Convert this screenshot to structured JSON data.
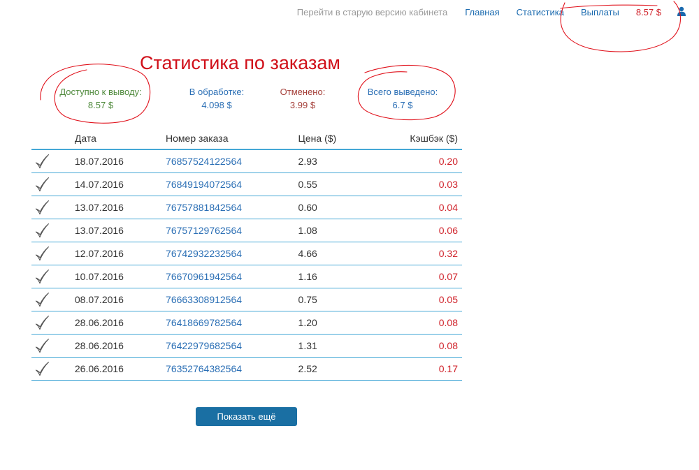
{
  "nav": {
    "old_version": "Перейти в старую версию кабинета",
    "home": "Главная",
    "statistics": "Статистика",
    "payouts": "Выплаты",
    "balance": "8.57 $",
    "user_icon": "user-icon"
  },
  "title": "Статистика по заказам",
  "stats": {
    "available": {
      "label": "Доступно к выводу:",
      "value": "8.57 $"
    },
    "processing": {
      "label": "В обработке:",
      "value": "4.098 $"
    },
    "cancelled": {
      "label": "Отменено:",
      "value": "3.99 $"
    },
    "withdrawn": {
      "label": "Всего выведено:",
      "value": "6.7 $"
    }
  },
  "table": {
    "headers": {
      "date": "Дата",
      "order_number": "Номер заказа",
      "price": "Цена ($)",
      "cashback": "Кэшбэк ($)"
    },
    "rows": [
      {
        "date": "18.07.2016",
        "order": "76857524122564",
        "price": "2.93",
        "cashback": "0.20"
      },
      {
        "date": "14.07.2016",
        "order": "76849194072564",
        "price": "0.55",
        "cashback": "0.03"
      },
      {
        "date": "13.07.2016",
        "order": "76757881842564",
        "price": "0.60",
        "cashback": "0.04"
      },
      {
        "date": "13.07.2016",
        "order": "76757129762564",
        "price": "1.08",
        "cashback": "0.06"
      },
      {
        "date": "12.07.2016",
        "order": "76742932232564",
        "price": "4.66",
        "cashback": "0.32"
      },
      {
        "date": "10.07.2016",
        "order": "76670961942564",
        "price": "1.16",
        "cashback": "0.07"
      },
      {
        "date": "08.07.2016",
        "order": "76663308912564",
        "price": "0.75",
        "cashback": "0.05"
      },
      {
        "date": "28.06.2016",
        "order": "76418669782564",
        "price": "1.20",
        "cashback": "0.08"
      },
      {
        "date": "28.06.2016",
        "order": "76422979682564",
        "price": "1.31",
        "cashback": "0.08"
      },
      {
        "date": "26.06.2016",
        "order": "76352764382564",
        "price": "2.52",
        "cashback": "0.17"
      }
    ]
  },
  "show_more": "Показать ещё",
  "colors": {
    "link": "#2b6fb5",
    "accent_red": "#d0232b",
    "row_border": "#45a8d6",
    "button": "#1a6fa3",
    "annotation": "#e0101a"
  }
}
